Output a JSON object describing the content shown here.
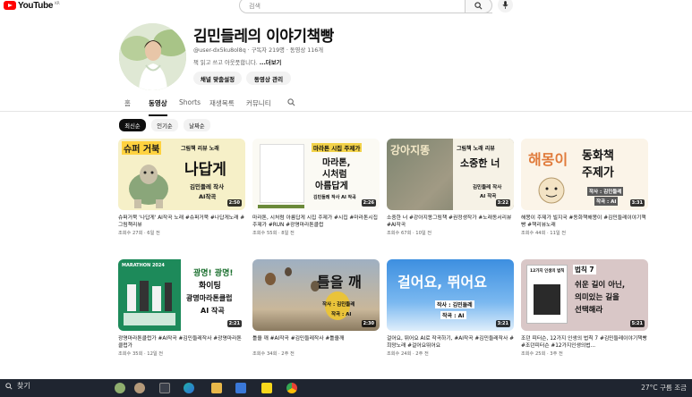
{
  "app": {
    "logo_text": "YouTube",
    "logo_suffix": "KR"
  },
  "search": {
    "placeholder": "검색"
  },
  "channel": {
    "title": "김민들레의 이야기책빵",
    "meta": "@user-dx5ku8ol8q · 구독자 219명 · 동영상 116개",
    "desc": "책 읽고 쓰고 아웃풋합니다.",
    "more": "...더보기",
    "btn_customize": "채널 맞춤설정",
    "btn_manage": "동영상 관리"
  },
  "tabs": [
    "홈",
    "동영상",
    "Shorts",
    "재생목록",
    "커뮤니티"
  ],
  "chips": [
    "최신순",
    "인기순",
    "날짜순"
  ],
  "videos": [
    {
      "title": "슈퍼거북 '나답게' AI작곡 노래 #슈퍼거북 #나답게노래 #그림책리뷰",
      "meta": "조회수 27회 · 6일 전",
      "duration": "2:50",
      "thumb_a": "슈퍼 거북",
      "thumb_b": "그림책 리뷰 노래",
      "thumb_c": "나답게",
      "thumb_d": "김민들레 작사",
      "thumb_e": "AI작곡"
    },
    {
      "title": "마라톤, 시처럼 아름답게 시집 주제가 #시집 #마라톤시집주제가 #RUN #광명마라톤클럽",
      "meta": "조회수 55회 · 8일 전",
      "duration": "2:26",
      "thumb_a": "마라톤 시집 주제가",
      "thumb_b": "마라톤,",
      "thumb_c": "시처럼",
      "thumb_d": "아름답게",
      "thumb_e": "김민들레 작사 AI 작곡"
    },
    {
      "title": "소중한 너 #강아지똥그림책 #권정생작가 #노래동서리뷰 #AI작곡",
      "meta": "조회수 67회 · 10일 전",
      "duration": "3:22",
      "thumb_a": "강아지똥",
      "thumb_b": "그림책 노래 리뷰",
      "thumb_c": "소중한 너",
      "thumb_d": "김민들레 작사",
      "thumb_e": "AI 작곡"
    },
    {
      "title": "해몽이 주제가 빌지국 #동화책해몽이 #김민들레이야기책빵 #책리뷰노래",
      "meta": "조회수 44회 · 11일 전",
      "duration": "3:31",
      "thumb_a": "해몽이",
      "thumb_b": "동화책",
      "thumb_c": "주제가",
      "thumb_d": "작사 : 김민들레",
      "thumb_e": "작곡 : AI"
    },
    {
      "title": "광명마라톤클럽가 #AI작곡 #김민들레작사 #광명마라톤클럽가",
      "meta": "조회수 35회 · 12일 전",
      "duration": "2:21",
      "thumb_a": "MARATHON 2024",
      "thumb_b": "광명! 광명!",
      "thumb_c": "화이팅",
      "thumb_d": "광명마라톤클럽",
      "thumb_e": "AI 작곡"
    },
    {
      "title": "틀을 깨 #AI작곡 #김민들레작사 #틀을깨",
      "meta": "조회수 34회 · 2주 전",
      "duration": "2:30",
      "thumb_a": "틀을 깨",
      "thumb_b": "작사 : 김민들레",
      "thumb_c": "작곡 : AI"
    },
    {
      "title": "걸어요, 뛰어요 AI로 작곡하기, #AI작곡 #김민들레작사 #희망노래 #걸어요뛰어요",
      "meta": "조회수 24회 · 2주 전",
      "duration": "3:21",
      "thumb_a": "걸어요, 뛰어요",
      "thumb_b": "작사 : 김민들레",
      "thumb_c": "작곡 : AI"
    },
    {
      "title": "조던 피터슨, 12가지 인생의 법칙 7 #김민들레이야기책빵 #조던피터슨 #12가지인생의법...",
      "meta": "조회수 25회 · 3주 전",
      "duration": "5:21",
      "thumb_a": "법칙 7",
      "thumb_b": "쉬운 길이 아닌,",
      "thumb_c": "의미있는 길을",
      "thumb_d": "선택해라",
      "thumb_e": "12가지 인생의 법칙"
    }
  ],
  "taskbar": {
    "search_label": "찾기",
    "weather": "27°C 구름 조금"
  },
  "colors": {
    "accent": "#ff0000",
    "chip_active": "#0f0f0f",
    "taskbar": "#1f2530"
  }
}
